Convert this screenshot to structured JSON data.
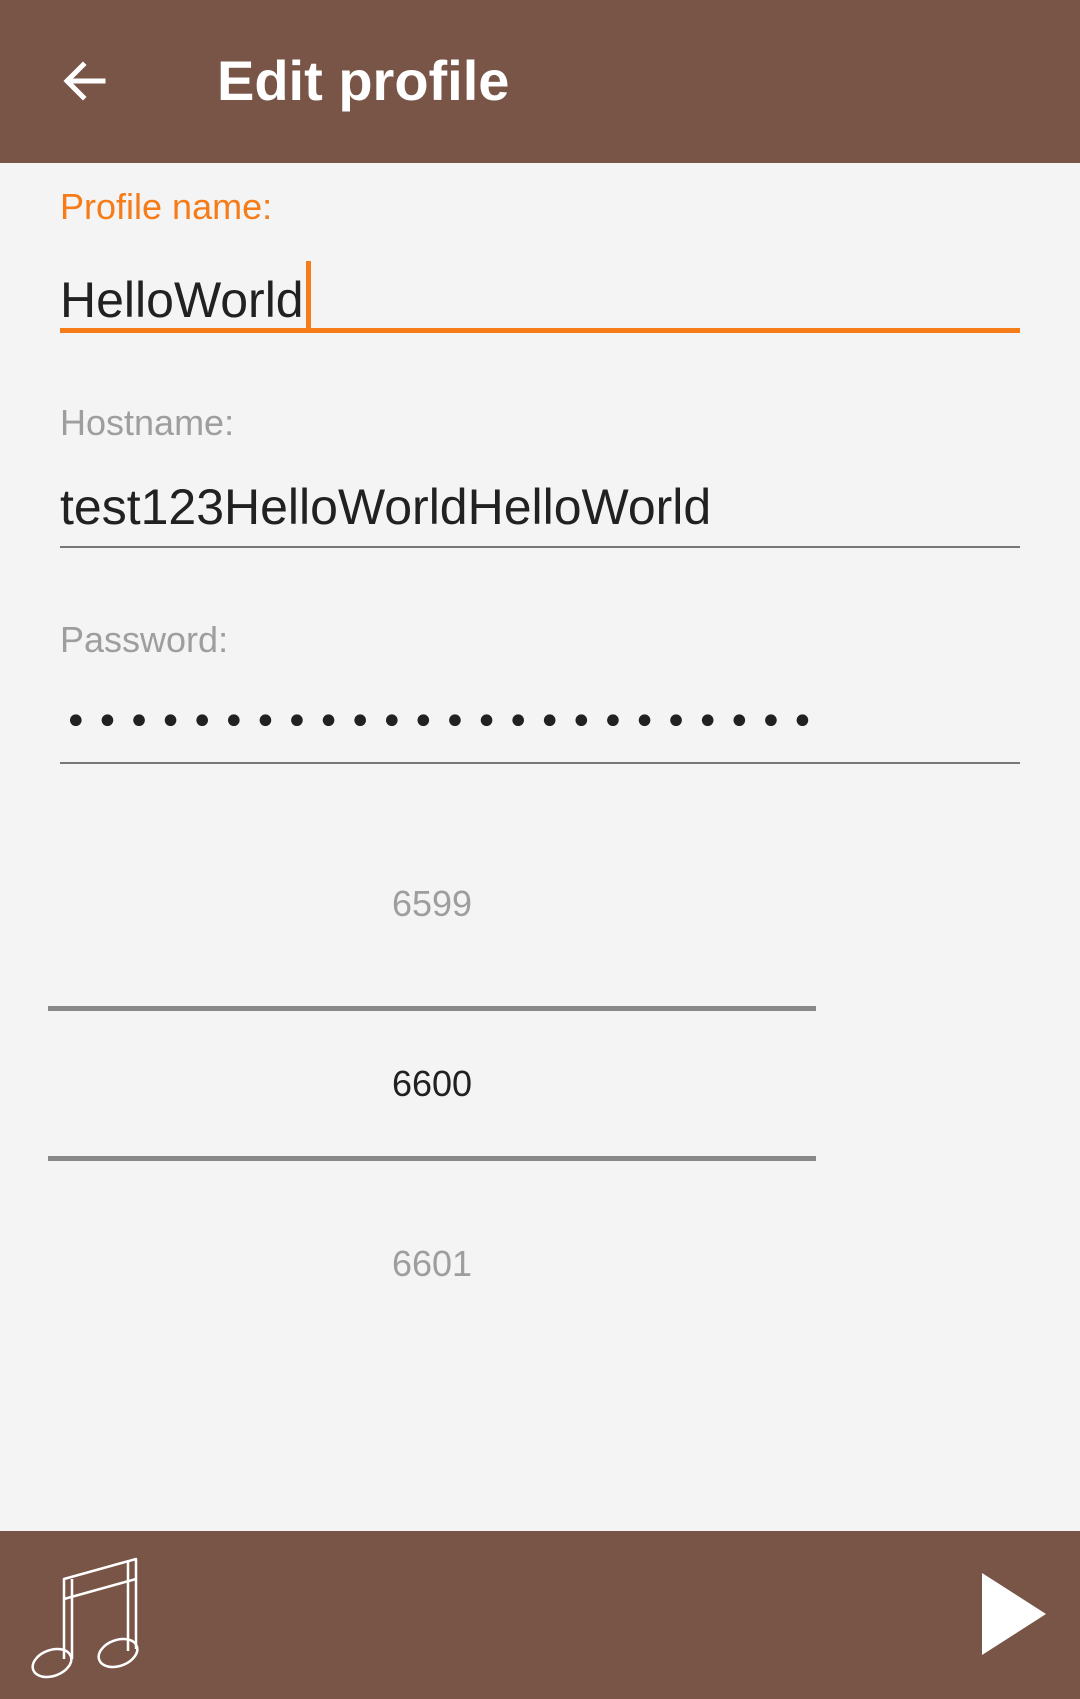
{
  "appbar": {
    "title": "Edit profile",
    "back_icon": "arrow-left-icon",
    "background": "#795548"
  },
  "form": {
    "profile_name": {
      "label": "Profile name:",
      "value": "HelloWorld",
      "focused": true
    },
    "hostname": {
      "label": "Hostname:",
      "value": "test123HelloWorldHelloWorld"
    },
    "password": {
      "label": "Password:",
      "masked_value": "••••••••••••••••••••••••"
    },
    "accent_color": "#f57c18"
  },
  "port_picker": {
    "previous": "6599",
    "selected": "6600",
    "next": "6601"
  },
  "bottombar": {
    "left_icon": "music-note-icon",
    "right_icon": "play-icon"
  }
}
